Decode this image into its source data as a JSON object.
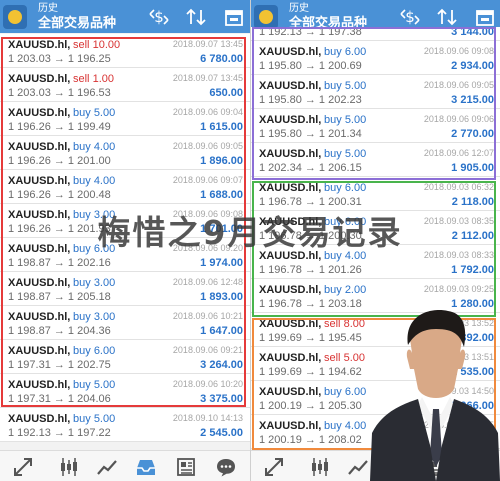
{
  "appbar": {
    "subtitle": "历史",
    "title": "全部交易品种"
  },
  "left": [
    {
      "symbol": "XAUUSD.hl,",
      "side": "sell",
      "volume": "10.00",
      "prices": "1 203.03 → 1 196.25",
      "time": "2018.09.07 13:45",
      "profit": "6 780.00"
    },
    {
      "symbol": "XAUUSD.hl,",
      "side": "sell",
      "volume": "1.00",
      "prices": "1 203.03 → 1 196.53",
      "time": "2018.09.07 13:45",
      "profit": "650.00"
    },
    {
      "symbol": "XAUUSD.hl,",
      "side": "buy",
      "volume": "5.00",
      "prices": "1 196.26 → 1 199.49",
      "time": "2018.09.06 09:04",
      "profit": "1 615.00"
    },
    {
      "symbol": "XAUUSD.hl,",
      "side": "buy",
      "volume": "4.00",
      "prices": "1 196.26 → 1 201.00",
      "time": "2018.09.06 09:05",
      "profit": "1 896.00"
    },
    {
      "symbol": "XAUUSD.hl,",
      "side": "buy",
      "volume": "4.00",
      "prices": "1 196.26 → 1 200.48",
      "time": "2018.09.06 09:07",
      "profit": "1 688.00"
    },
    {
      "symbol": "XAUUSD.hl,",
      "side": "buy",
      "volume": "3.00",
      "prices": "1 196.26 → 1 201.93",
      "time": "2018.09.06 09:08",
      "profit": "1 701.00"
    },
    {
      "symbol": "XAUUSD.hl,",
      "side": "buy",
      "volume": "6.00",
      "prices": "1 198.87 → 1 202.16",
      "time": "2018.09.06 09:20",
      "profit": "1 974.00"
    },
    {
      "symbol": "XAUUSD.hl,",
      "side": "buy",
      "volume": "3.00",
      "prices": "1 198.87 → 1 205.18",
      "time": "2018.09.06 12:48",
      "profit": "1 893.00"
    },
    {
      "symbol": "XAUUSD.hl,",
      "side": "buy",
      "volume": "3.00",
      "prices": "1 198.87 → 1 204.36",
      "time": "2018.09.06 10:21",
      "profit": "1 647.00"
    },
    {
      "symbol": "XAUUSD.hl,",
      "side": "buy",
      "volume": "6.00",
      "prices": "1 197.31 → 1 202.75",
      "time": "2018.09.06 09:21",
      "profit": "3 264.00"
    },
    {
      "symbol": "XAUUSD.hl,",
      "side": "buy",
      "volume": "5.00",
      "prices": "1 197.31 → 1 204.06",
      "time": "2018.09.06 10:20",
      "profit": "3 375.00"
    },
    {
      "symbol": "XAUUSD.hl,",
      "side": "buy",
      "volume": "5.00",
      "prices": "1 192.13 → 1 197.22",
      "time": "2018.09.10 14:13",
      "profit": "2 545.00"
    }
  ],
  "right": [
    {
      "symbol": "",
      "side": "",
      "volume": "",
      "prices": "1 192.13 → 1 197.38",
      "time": "",
      "profit": "3 144.00"
    },
    {
      "symbol": "XAUUSD.hl,",
      "side": "buy",
      "volume": "6.00",
      "prices": "1 195.80 → 1 200.69",
      "time": "2018.09.06 09:08",
      "profit": "2 934.00"
    },
    {
      "symbol": "XAUUSD.hl,",
      "side": "buy",
      "volume": "5.00",
      "prices": "1 195.80 → 1 202.23",
      "time": "2018.09.06 09:05",
      "profit": "3 215.00"
    },
    {
      "symbol": "XAUUSD.hl,",
      "side": "buy",
      "volume": "5.00",
      "prices": "1 195.80 → 1 201.34",
      "time": "2018.09.06 09:06",
      "profit": "2 770.00"
    },
    {
      "symbol": "XAUUSD.hl,",
      "side": "buy",
      "volume": "5.00",
      "prices": "1 202.34 → 1 206.15",
      "time": "2018.09.06 12:07",
      "profit": "1 905.00"
    },
    {
      "symbol": "XAUUSD.hl,",
      "side": "buy",
      "volume": "6.00",
      "prices": "1 196.78 → 1 200.31",
      "time": "2018.09.03 06:32",
      "profit": "2 118.00"
    },
    {
      "symbol": "XAUUSD.hl,",
      "side": "buy",
      "volume": "6.00",
      "prices": "1 196.78 → 1 200.30",
      "time": "2018.09.03 08:35",
      "profit": "2 112.00"
    },
    {
      "symbol": "XAUUSD.hl,",
      "side": "buy",
      "volume": "4.00",
      "prices": "1 196.78 → 1 201.26",
      "time": "2018.09.03 08:33",
      "profit": "1 792.00"
    },
    {
      "symbol": "XAUUSD.hl,",
      "side": "buy",
      "volume": "2.00",
      "prices": "1 196.78 → 1 203.18",
      "time": "2018.09.03 09:25",
      "profit": "1 280.00"
    },
    {
      "symbol": "XAUUSD.hl,",
      "side": "sell",
      "volume": "8.00",
      "prices": "1 199.69 → 1 195.45",
      "time": "2018.09.03 13:52",
      "profit": "3 392.00"
    },
    {
      "symbol": "XAUUSD.hl,",
      "side": "sell",
      "volume": "5.00",
      "prices": "1 199.69 → 1 194.62",
      "time": "2018.09.03 13:51",
      "profit": "2 535.00"
    },
    {
      "symbol": "XAUUSD.hl,",
      "side": "buy",
      "volume": "6.00",
      "prices": "1 200.19 → 1 205.30",
      "time": "2018.09.03 14:50",
      "profit": "3 066.00"
    },
    {
      "symbol": "XAUUSD.hl,",
      "side": "buy",
      "volume": "4.00",
      "prices": "1 200.19 → 1 208.02",
      "time": "2018.09.03 08:05",
      "profit": "3 132.00"
    }
  ],
  "watermark": "梅惜之9月交易记录",
  "colors": {
    "appbar": "#4a91d6",
    "buy": "#2a72c8",
    "sell": "#d83333",
    "profit": "#2a72c8"
  },
  "icons": {
    "toolbar": [
      "dollar-swap-icon",
      "sort-arrows-icon",
      "calendar-icon"
    ],
    "nav": [
      "trade-arrows-icon",
      "candlestick-icon",
      "line-chart-icon",
      "history-tray-icon",
      "news-icon",
      "chat-icon"
    ]
  }
}
